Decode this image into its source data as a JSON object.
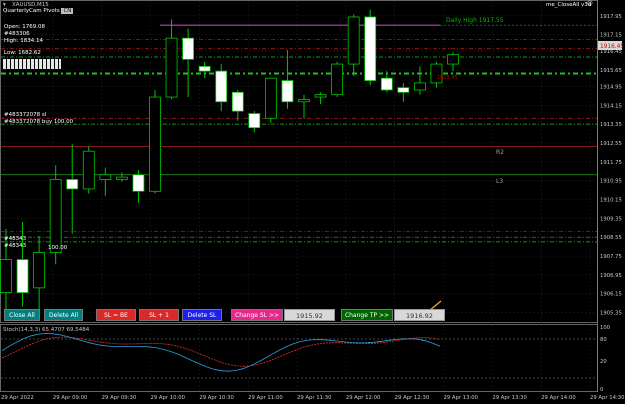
{
  "window": {
    "symbol": "XAUUSD,M15",
    "ea_name": "me_CloseAll v3d"
  },
  "info": {
    "pivots": "QuarterlyCam Pivots",
    "pivots_tag": "CN",
    "open": "Open: 1769.08",
    "ticket1": "#483306",
    "high": "High: 1834.14",
    "low": "Low: 1682.62",
    "ticket_l1": "#483372078 sl",
    "ticket_l2": "#483372078 buy 100.00",
    "ticket_b1": "#48343",
    "ticket_b2": "#48343",
    "small_val": "100.00"
  },
  "levels": {
    "daily_high": "Daily High 1917.55",
    "r2": "R2",
    "l3": "L3",
    "line_value": "1915.45"
  },
  "price_axis": {
    "labels": [
      "1917.95",
      "1917.15",
      "1916.45",
      "1915.65",
      "1914.95",
      "1914.15",
      "1913.35",
      "1912.55",
      "1911.75",
      "1910.95",
      "1910.15",
      "1909.35",
      "1908.55",
      "1907.75",
      "1906.95",
      "1906.15",
      "1905.35"
    ],
    "current": "1916.45"
  },
  "osc": {
    "label": "Stoch(14,3,3) 65.4707 69.5484",
    "axis": [
      "100",
      "80",
      "20",
      "0"
    ]
  },
  "time_axis": [
    "29 Apr 2022",
    "29 Apr 09:00",
    "29 Apr 09:30",
    "29 Apr 10:00",
    "29 Apr 10:30",
    "29 Apr 11:00",
    "29 Apr 11:30",
    "29 Apr 12:00",
    "29 Apr 12:30",
    "29 Apr 13:00",
    "29 Apr 13:30",
    "29 Apr 14:00",
    "29 Apr 14:30"
  ],
  "buttons": {
    "close_all": "Close All",
    "delete_all": "Delete All",
    "sl_be": "SL = BE",
    "sl_plus1": "SL + 1",
    "delete_sl": "Delete SL",
    "change_sl": "Change SL >>",
    "sl_price": "1915.92",
    "change_tp": "Change TP >>",
    "tp_price": "1916.92"
  },
  "colors": {
    "bull": "#ffffff",
    "bear": "#000000",
    "wick": "#00c800",
    "grid": "#1e1e1e",
    "close_btn": "#008080",
    "red_btn": "#dc2828",
    "blue_btn": "#1e1ef0",
    "pink_btn": "#e6288c",
    "green_btn": "#006400"
  },
  "chart_data": {
    "type": "candlestick",
    "candles": [
      {
        "o": 1906.2,
        "h": 1908.9,
        "l": 1905.5,
        "c": 1907.6
      },
      {
        "o": 1907.6,
        "h": 1909.2,
        "l": 1905.6,
        "c": 1906.2
      },
      {
        "o": 1906.4,
        "h": 1908.6,
        "l": 1905.5,
        "c": 1907.9
      },
      {
        "o": 1907.9,
        "h": 1911.6,
        "l": 1907.4,
        "c": 1911.0
      },
      {
        "o": 1911.0,
        "h": 1912.5,
        "l": 1908.7,
        "c": 1910.6
      },
      {
        "o": 1910.6,
        "h": 1912.4,
        "l": 1910.4,
        "c": 1912.2
      },
      {
        "o": 1911.0,
        "h": 1911.5,
        "l": 1910.3,
        "c": 1911.2
      },
      {
        "o": 1911.0,
        "h": 1911.3,
        "l": 1910.9,
        "c": 1911.1
      },
      {
        "o": 1911.2,
        "h": 1911.4,
        "l": 1910.0,
        "c": 1910.5
      },
      {
        "o": 1910.5,
        "h": 1914.8,
        "l": 1910.4,
        "c": 1914.5
      },
      {
        "o": 1914.5,
        "h": 1917.8,
        "l": 1914.4,
        "c": 1917.0
      },
      {
        "o": 1917.0,
        "h": 1917.4,
        "l": 1914.5,
        "c": 1916.1
      },
      {
        "o": 1915.8,
        "h": 1916.0,
        "l": 1915.3,
        "c": 1915.6
      },
      {
        "o": 1915.6,
        "h": 1915.9,
        "l": 1913.9,
        "c": 1914.3
      },
      {
        "o": 1914.7,
        "h": 1914.8,
        "l": 1913.5,
        "c": 1913.9
      },
      {
        "o": 1913.8,
        "h": 1913.9,
        "l": 1913.0,
        "c": 1913.2
      },
      {
        "o": 1913.6,
        "h": 1915.3,
        "l": 1913.4,
        "c": 1915.3
      },
      {
        "o": 1915.2,
        "h": 1916.5,
        "l": 1914.0,
        "c": 1914.3
      },
      {
        "o": 1914.3,
        "h": 1914.6,
        "l": 1913.6,
        "c": 1914.4
      },
      {
        "o": 1914.5,
        "h": 1914.7,
        "l": 1914.2,
        "c": 1914.6
      },
      {
        "o": 1914.6,
        "h": 1916.0,
        "l": 1914.5,
        "c": 1915.9
      },
      {
        "o": 1915.9,
        "h": 1918.0,
        "l": 1915.4,
        "c": 1917.9
      },
      {
        "o": 1917.9,
        "h": 1918.2,
        "l": 1915.0,
        "c": 1915.2
      },
      {
        "o": 1915.3,
        "h": 1915.6,
        "l": 1914.7,
        "c": 1914.8
      },
      {
        "o": 1914.9,
        "h": 1915.1,
        "l": 1914.3,
        "c": 1914.7
      },
      {
        "o": 1914.8,
        "h": 1915.8,
        "l": 1914.6,
        "c": 1915.1
      },
      {
        "o": 1915.1,
        "h": 1916.0,
        "l": 1914.9,
        "c": 1915.9
      },
      {
        "o": 1915.9,
        "h": 1916.4,
        "l": 1915.6,
        "c": 1916.3
      }
    ],
    "ylim": [
      1904.95,
      1918.45
    ],
    "horizontal_levels": {
      "daily_high": 1917.55,
      "r2": 1912.4,
      "l3": 1911.2,
      "red_dash": [
        1916.95,
        1916.55,
        1913.6,
        1908.8
      ],
      "green_dash": [
        1916.2,
        1915.5,
        1913.35,
        1908.55,
        1908.35
      ]
    },
    "stochastic": {
      "main": 65.4707,
      "signal": 69.5484
    }
  }
}
